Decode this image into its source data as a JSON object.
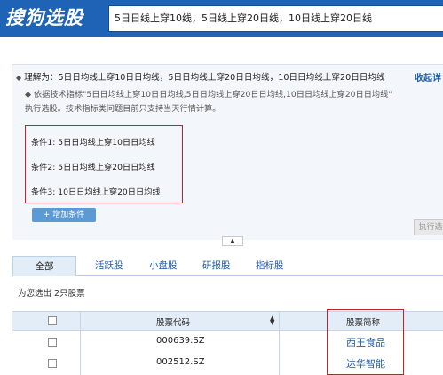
{
  "header": {
    "logo_text": "搜狗选股",
    "query": "5日日线上穿10线，5日线上穿20日线，10日线上穿20日线"
  },
  "understanding": {
    "text": "理解为：5日日均线上穿10日日均线，5日日均线上穿20日日均线，10日日均线上穿20日日均线",
    "collapse_label": "收起详",
    "note_line1": "依据技术指标\"5日日均线上穿10日日均线,5日日均线上穿20日日均线,10日日均线上穿20日日均线\"",
    "note_line2": "执行选股。技术指标类问题目前只支持当天行情计算。"
  },
  "conditions": [
    {
      "label": "条件1:",
      "value": "5日日均线上穿10日日均线"
    },
    {
      "label": "条件2:",
      "value": "5日日均线上穿20日日均线"
    },
    {
      "label": "条件3:",
      "value": "10日日均线上穿20日日均线"
    }
  ],
  "buttons": {
    "add_condition": "+ 增加条件",
    "run_screen": "执行选股"
  },
  "tabs": [
    "全部",
    "活跃股",
    "小盘股",
    "研报股",
    "指标股"
  ],
  "result_count": "为您选出 2只股票",
  "table": {
    "headers": {
      "code": "股票代码",
      "name": "股票简称"
    },
    "rows": [
      {
        "code": "000639.SZ",
        "name": "西王食品"
      },
      {
        "code": "002512.SZ",
        "name": "达华智能"
      }
    ]
  },
  "colors": {
    "brand_blue": "#1e63b6",
    "highlight_red": "#c0242a",
    "link_blue": "#1f5da8"
  }
}
